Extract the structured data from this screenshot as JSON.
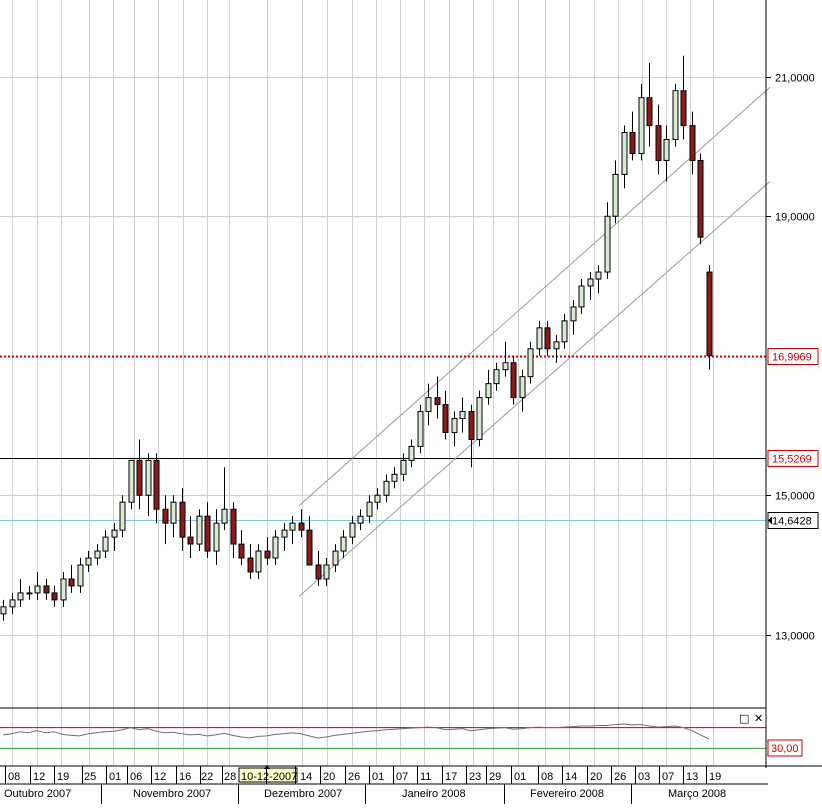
{
  "chart_data": {
    "type": "candlestick",
    "price_scale": {
      "ticks": [
        "21,0000",
        "19,0000",
        "15,0000",
        "13,0000"
      ],
      "tick_values": [
        21,
        19,
        15,
        13
      ],
      "range": [
        11.95,
        22.1
      ]
    },
    "markers": [
      {
        "value": 16.9969,
        "label": "16,9969",
        "color": "#cc0000",
        "style": "dotted"
      },
      {
        "value": 15.5269,
        "label": "15,5269",
        "color": "#000000",
        "style": "solid"
      },
      {
        "value": 14.6428,
        "label": "14,6428",
        "color": "#7ec8e3",
        "style": "solid"
      }
    ],
    "crosshair_date": "10-12-2007",
    "day_ticks": [
      "08",
      "12",
      "19",
      "25",
      "01",
      "06",
      "12",
      "16",
      "22",
      "28",
      "10-12-2007",
      "14",
      "20",
      "26",
      "01",
      "07",
      "11",
      "17",
      "23",
      "29",
      "01",
      "08",
      "14",
      "20",
      "26",
      "03",
      "07",
      "13",
      "19"
    ],
    "month_labels": [
      "Outubro 2007",
      "Novembro 2007",
      "Dezembro 2007",
      "Janeiro 2008",
      "Fevereiro 2008",
      "Março 2008"
    ],
    "channel": {
      "upper": {
        "from": 14.85,
        "to": 20.85
      },
      "lower": {
        "from": 13.55,
        "to": 19.5
      }
    },
    "candles": [
      [
        13.3,
        13.5,
        13.2,
        13.4
      ],
      [
        13.4,
        13.6,
        13.3,
        13.5
      ],
      [
        13.5,
        13.8,
        13.4,
        13.6
      ],
      [
        13.6,
        13.7,
        13.5,
        13.6
      ],
      [
        13.6,
        13.9,
        13.5,
        13.7
      ],
      [
        13.7,
        13.8,
        13.5,
        13.6
      ],
      [
        13.6,
        13.7,
        13.4,
        13.5
      ],
      [
        13.5,
        13.9,
        13.4,
        13.8
      ],
      [
        13.8,
        14.0,
        13.6,
        13.7
      ],
      [
        13.7,
        14.1,
        13.6,
        14.0
      ],
      [
        14.0,
        14.2,
        13.9,
        14.1
      ],
      [
        14.1,
        14.3,
        14.0,
        14.2
      ],
      [
        14.2,
        14.5,
        14.1,
        14.4
      ],
      [
        14.4,
        14.6,
        14.2,
        14.5
      ],
      [
        14.5,
        15.0,
        14.4,
        14.9
      ],
      [
        14.9,
        15.5,
        14.8,
        15.5
      ],
      [
        15.5,
        15.8,
        14.8,
        15.0
      ],
      [
        15.0,
        15.6,
        14.7,
        15.5
      ],
      [
        15.5,
        15.6,
        14.6,
        14.8
      ],
      [
        14.8,
        15.0,
        14.3,
        14.6
      ],
      [
        14.6,
        15.0,
        14.4,
        14.9
      ],
      [
        14.9,
        15.1,
        14.2,
        14.4
      ],
      [
        14.4,
        14.7,
        14.1,
        14.3
      ],
      [
        14.3,
        14.8,
        14.2,
        14.7
      ],
      [
        14.7,
        14.9,
        14.1,
        14.2
      ],
      [
        14.2,
        14.8,
        14.0,
        14.6
      ],
      [
        14.6,
        15.4,
        14.5,
        14.8
      ],
      [
        14.8,
        14.9,
        14.1,
        14.3
      ],
      [
        14.3,
        14.5,
        14.0,
        14.1
      ],
      [
        14.1,
        14.3,
        13.8,
        13.9
      ],
      [
        13.9,
        14.3,
        13.8,
        14.2
      ],
      [
        14.2,
        14.4,
        14.0,
        14.1
      ],
      [
        14.1,
        14.5,
        14.0,
        14.4
      ],
      [
        14.4,
        14.6,
        14.2,
        14.5
      ],
      [
        14.5,
        14.7,
        14.3,
        14.6
      ],
      [
        14.6,
        14.8,
        14.4,
        14.5
      ],
      [
        14.5,
        14.7,
        14.0,
        14.0
      ],
      [
        14.0,
        14.2,
        13.7,
        13.8
      ],
      [
        13.8,
        14.1,
        13.7,
        14.0
      ],
      [
        14.0,
        14.3,
        13.9,
        14.2
      ],
      [
        14.2,
        14.5,
        14.1,
        14.4
      ],
      [
        14.4,
        14.7,
        14.3,
        14.6
      ],
      [
        14.6,
        14.8,
        14.5,
        14.7
      ],
      [
        14.7,
        15.0,
        14.6,
        14.9
      ],
      [
        14.9,
        15.1,
        14.8,
        15.0
      ],
      [
        15.0,
        15.3,
        14.9,
        15.2
      ],
      [
        15.2,
        15.4,
        15.1,
        15.3
      ],
      [
        15.3,
        15.6,
        15.2,
        15.5
      ],
      [
        15.5,
        15.8,
        15.4,
        15.7
      ],
      [
        15.7,
        16.3,
        15.6,
        16.2
      ],
      [
        16.2,
        16.6,
        16.0,
        16.4
      ],
      [
        16.4,
        16.7,
        16.1,
        16.3
      ],
      [
        16.3,
        16.5,
        15.8,
        15.9
      ],
      [
        15.9,
        16.2,
        15.7,
        16.1
      ],
      [
        16.1,
        16.4,
        15.9,
        16.2
      ],
      [
        16.2,
        16.3,
        15.4,
        15.8
      ],
      [
        15.8,
        16.5,
        15.7,
        16.4
      ],
      [
        16.4,
        16.8,
        16.3,
        16.6
      ],
      [
        16.6,
        16.9,
        16.5,
        16.8
      ],
      [
        16.8,
        17.2,
        16.7,
        16.9
      ],
      [
        16.9,
        17.0,
        16.3,
        16.4
      ],
      [
        16.4,
        16.8,
        16.2,
        16.7
      ],
      [
        16.7,
        17.2,
        16.6,
        17.1
      ],
      [
        17.1,
        17.5,
        17.0,
        17.4
      ],
      [
        17.4,
        17.5,
        17.0,
        17.1
      ],
      [
        17.1,
        17.3,
        16.9,
        17.2
      ],
      [
        17.2,
        17.6,
        17.1,
        17.5
      ],
      [
        17.5,
        17.8,
        17.3,
        17.7
      ],
      [
        17.7,
        18.1,
        17.6,
        18.0
      ],
      [
        18.0,
        18.2,
        17.8,
        18.1
      ],
      [
        18.1,
        18.3,
        17.9,
        18.2
      ],
      [
        18.2,
        19.2,
        18.1,
        19.0
      ],
      [
        19.0,
        19.8,
        18.9,
        19.6
      ],
      [
        19.6,
        20.3,
        19.4,
        20.2
      ],
      [
        20.2,
        20.5,
        19.8,
        19.9
      ],
      [
        19.9,
        20.9,
        19.8,
        20.7
      ],
      [
        20.7,
        21.2,
        20.0,
        20.3
      ],
      [
        20.3,
        20.6,
        19.6,
        19.8
      ],
      [
        19.8,
        20.3,
        19.5,
        20.1
      ],
      [
        20.1,
        20.9,
        20.0,
        20.8
      ],
      [
        20.8,
        21.3,
        20.1,
        20.3
      ],
      [
        20.3,
        20.5,
        19.6,
        19.8
      ],
      [
        19.8,
        19.9,
        18.6,
        18.7
      ],
      [
        18.2,
        18.3,
        16.8,
        17.0
      ]
    ],
    "indicator": {
      "label": "30,00",
      "upper_level": 70,
      "lower_level": 30,
      "range": [
        0,
        100
      ],
      "values": [
        56,
        58,
        62,
        60,
        64,
        60,
        62,
        57,
        55,
        54,
        58,
        60,
        62,
        63,
        66,
        70,
        66,
        68,
        63,
        60,
        61,
        58,
        56,
        57,
        54,
        56,
        59,
        55,
        52,
        50,
        53,
        54,
        57,
        58,
        60,
        58,
        54,
        50,
        52,
        55,
        57,
        59,
        61,
        63,
        64,
        66,
        67,
        68,
        69,
        70,
        71,
        70,
        66,
        67,
        68,
        64,
        66,
        68,
        69,
        70,
        67,
        68,
        70,
        71,
        70,
        70,
        71,
        72,
        73,
        73,
        74,
        74,
        76,
        77,
        75,
        76,
        73,
        71,
        72,
        73,
        70,
        64,
        56,
        48
      ]
    }
  },
  "controls": {
    "restore_symbol": "□",
    "close_symbol": "✕"
  },
  "colors": {
    "up_body": "#d9ead3",
    "down_body": "#8b1a1a",
    "grid": "#cfcfcf",
    "crosshair": "#a8d4ec"
  }
}
